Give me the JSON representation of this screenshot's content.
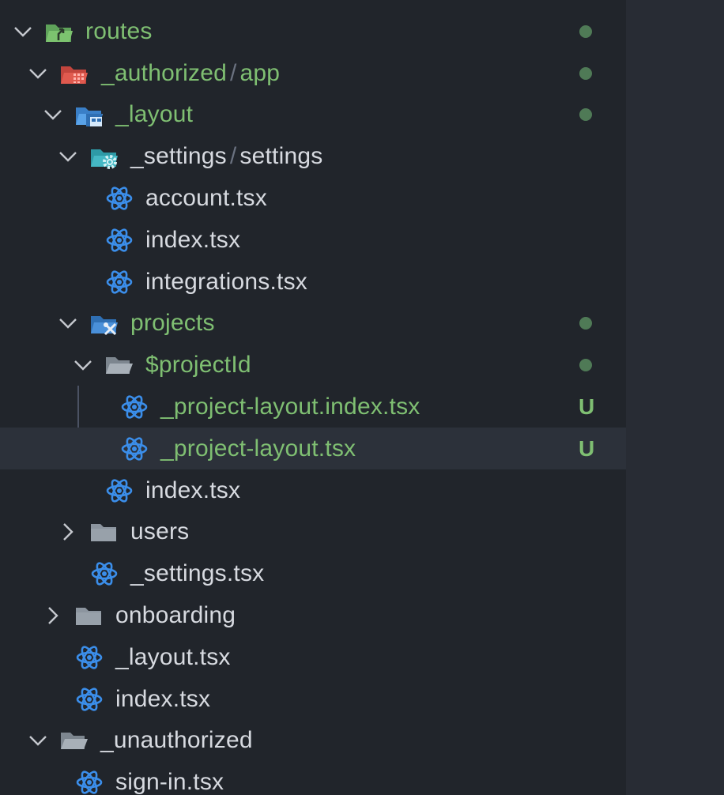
{
  "colors": {
    "sidebar_bg": "#21252b",
    "selected_row": "#2c313a",
    "git_untracked": "#7fbf72",
    "git_dot": "#4f7a56",
    "react_icon": "#3b8eea",
    "folder_gray": "#8c959f"
  },
  "explorer": {
    "items": [
      {
        "name": "routes",
        "kind": "folder",
        "expanded": true,
        "icon": "folder-routes-icon",
        "git": "dot"
      },
      {
        "name": "_authorized",
        "sub": "app",
        "kind": "folder",
        "expanded": true,
        "icon": "folder-app-icon",
        "git": "dot"
      },
      {
        "name": "_layout",
        "kind": "folder",
        "expanded": true,
        "icon": "folder-layout-icon",
        "git": "dot"
      },
      {
        "name": "_settings",
        "sub": "settings",
        "kind": "folder",
        "expanded": true,
        "icon": "folder-settings-icon",
        "git": ""
      },
      {
        "name": "account.tsx",
        "kind": "file",
        "icon": "react-icon",
        "git": ""
      },
      {
        "name": "index.tsx",
        "kind": "file",
        "icon": "react-icon",
        "git": ""
      },
      {
        "name": "integrations.tsx",
        "kind": "file",
        "icon": "react-icon",
        "git": ""
      },
      {
        "name": "projects",
        "kind": "folder",
        "expanded": true,
        "icon": "folder-projects-icon",
        "git": "dot"
      },
      {
        "name": "$projectId",
        "kind": "folder",
        "expanded": true,
        "icon": "folder-open-icon",
        "git": "dot"
      },
      {
        "name": "_project-layout.index.tsx",
        "kind": "file",
        "icon": "react-icon",
        "git": "U"
      },
      {
        "name": "_project-layout.tsx",
        "kind": "file",
        "icon": "react-icon",
        "git": "U",
        "selected": true
      },
      {
        "name": "index.tsx",
        "kind": "file",
        "icon": "react-icon",
        "git": ""
      },
      {
        "name": "users",
        "kind": "folder",
        "expanded": false,
        "icon": "folder-icon",
        "git": ""
      },
      {
        "name": "_settings.tsx",
        "kind": "file",
        "icon": "react-icon",
        "git": ""
      },
      {
        "name": "onboarding",
        "kind": "folder",
        "expanded": false,
        "icon": "folder-icon",
        "git": ""
      },
      {
        "name": "_layout.tsx",
        "kind": "file",
        "icon": "react-icon",
        "git": ""
      },
      {
        "name": "index.tsx",
        "kind": "file",
        "icon": "react-icon",
        "git": ""
      },
      {
        "name": "_unauthorized",
        "kind": "folder",
        "expanded": true,
        "icon": "folder-open-icon",
        "git": ""
      },
      {
        "name": "sign-in.tsx",
        "kind": "file",
        "icon": "react-icon",
        "git": ""
      }
    ]
  }
}
